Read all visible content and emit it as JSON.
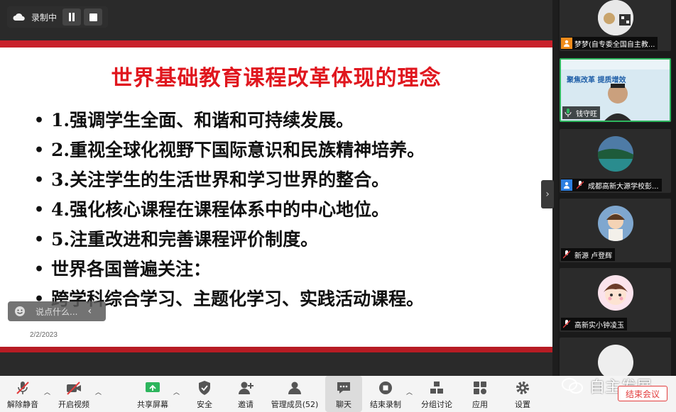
{
  "recording": {
    "label": "录制中"
  },
  "slide": {
    "title": "世界基础教育课程改革体现的理念",
    "bullets": [
      "1.强调学生全面、和谐和可持续发展。",
      "2.重视全球化视野下国际意识和民族精神培养。",
      "3.关注学生的生活世界和学习世界的整合。",
      "4.强化核心课程在课程体系中的中心地位。",
      "5.注重改进和完善课程评价制度。",
      "世界各国普遍关注：",
      " 跨学科综合学习、主题化学习、实践活动课程。"
    ],
    "date": "2/2/2023"
  },
  "chat_input": {
    "placeholder": "说点什么..."
  },
  "participants": [
    {
      "name": "梦梦(自专委全国自主教...",
      "icon": "user-icon"
    },
    {
      "name": "钱守旺",
      "icon": "mic-icon",
      "active": true,
      "slide_text": "聚焦改革  提质增效"
    },
    {
      "name": "成都高新大源学校彭...",
      "icon": "user-icon"
    },
    {
      "name": "新源 卢登辉",
      "icon": "mic-muted-icon"
    },
    {
      "name": "高新实小钟凌玉",
      "icon": "mic-muted-icon"
    }
  ],
  "toolbar": {
    "mute": "解除静音",
    "video": "开启视频",
    "share": "共享屏幕",
    "security": "安全",
    "invite": "邀请",
    "members": "管理成员(52)",
    "chat": "聊天",
    "stop_record": "结束录制",
    "breakout": "分组讨论",
    "apps": "应用",
    "settings": "设置",
    "end_meeting": "结束会议"
  },
  "watermark": {
    "text": "自主发展"
  },
  "colors": {
    "title_red": "#e0161e",
    "active_green": "#2db55d",
    "end_red": "#e23b3b"
  }
}
